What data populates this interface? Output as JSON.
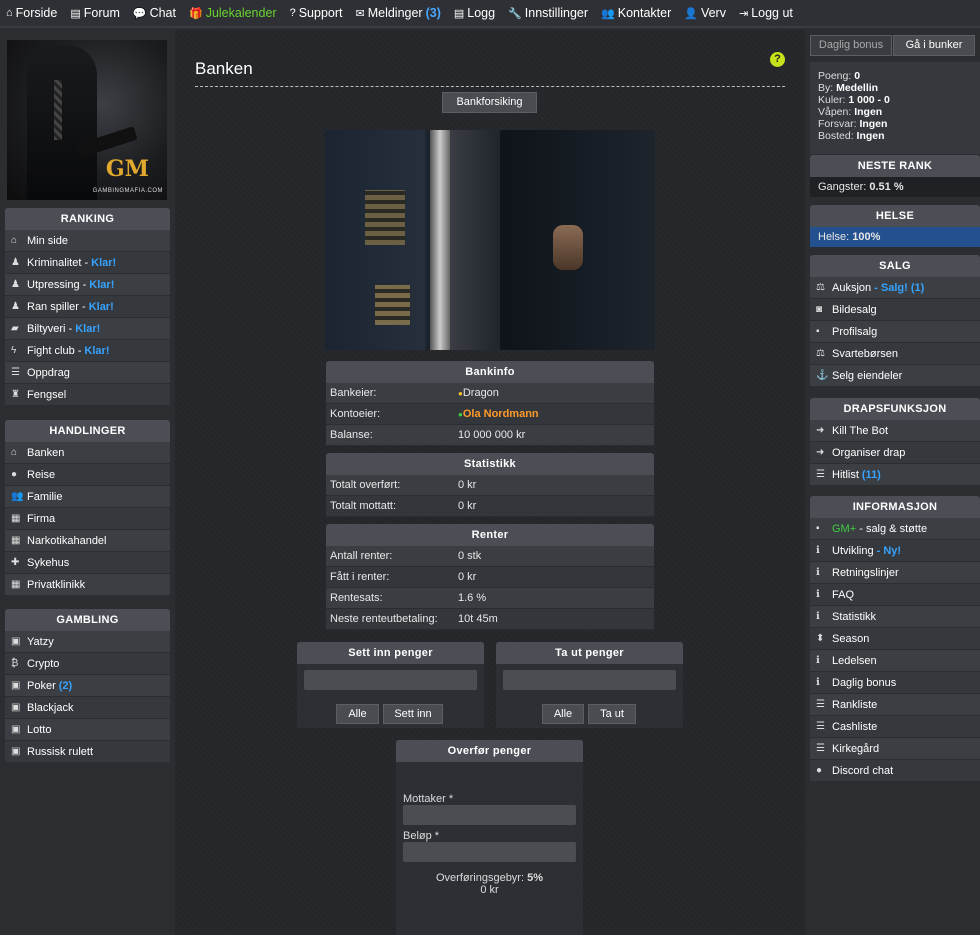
{
  "nav": [
    {
      "icon": "⌂",
      "label": "Forside",
      "icon_name": "home-icon"
    },
    {
      "icon": "▤",
      "label": "Forum",
      "icon_name": "forum-icon"
    },
    {
      "icon": "💬",
      "label": "Chat",
      "icon_name": "chat-icon"
    },
    {
      "icon": "🎁",
      "label": "Julekalender",
      "icon_name": "gift-icon"
    },
    {
      "icon": "?",
      "label": "Support",
      "icon_name": "question-icon"
    },
    {
      "icon": "✉",
      "label": "Meldinger",
      "count": "(3)",
      "icon_name": "envelope-icon"
    },
    {
      "icon": "▤",
      "label": "Logg",
      "icon_name": "list-icon"
    },
    {
      "icon": "🔧",
      "label": "Innstillinger",
      "icon_name": "wrench-icon"
    },
    {
      "icon": "👥",
      "label": "Kontakter",
      "icon_name": "users-icon"
    },
    {
      "icon": "👤",
      "label": "Verv",
      "icon_name": "user-plus-icon"
    },
    {
      "icon": "⇥",
      "label": "Logg ut",
      "icon_name": "logout-icon"
    }
  ],
  "logo": {
    "mark_g": "G",
    "mark_m": "M",
    "site": "GAMBINGMAFIA.COM"
  },
  "left": {
    "ranking": {
      "title": "RANKING",
      "items": [
        {
          "label": "Min side",
          "ready": ""
        },
        {
          "label": "Kriminalitet -",
          "ready": "Klar!"
        },
        {
          "label": "Utpressing -",
          "ready": "Klar!"
        },
        {
          "label": "Ran spiller -",
          "ready": "Klar!"
        },
        {
          "label": "Biltyveri -",
          "ready": "Klar!"
        },
        {
          "label": "Fight club -",
          "ready": "Klar!"
        },
        {
          "label": "Oppdrag",
          "ready": ""
        },
        {
          "label": "Fengsel",
          "ready": ""
        }
      ]
    },
    "handlinger": {
      "title": "HANDLINGER",
      "items": [
        "Banken",
        "Reise",
        "Familie",
        "Firma",
        "Narkotikahandel",
        "Sykehus",
        "Privatklinikk"
      ]
    },
    "gambling": {
      "title": "GAMBLING",
      "items": [
        {
          "label": "Yatzy",
          "count": ""
        },
        {
          "label": "Crypto",
          "count": ""
        },
        {
          "label": "Poker",
          "count": "(2)"
        },
        {
          "label": "Blackjack",
          "count": ""
        },
        {
          "label": "Lotto",
          "count": ""
        },
        {
          "label": "Russisk rulett",
          "count": ""
        }
      ]
    }
  },
  "main": {
    "title": "Banken",
    "help": "?",
    "bank_button": "Bankforsiking",
    "bankinfo": {
      "title": "Bankinfo",
      "rows": [
        {
          "k": "Bankeier:",
          "v": "Dragon"
        },
        {
          "k": "Kontoeier:",
          "v": "Ola Nordmann"
        },
        {
          "k": "Balanse:",
          "v": "10 000 000 kr"
        }
      ]
    },
    "statistikk": {
      "title": "Statistikk",
      "rows": [
        {
          "k": "Totalt overført:",
          "v": "0 kr"
        },
        {
          "k": "Totalt mottatt:",
          "v": "0 kr"
        }
      ]
    },
    "renter": {
      "title": "Renter",
      "rows": [
        {
          "k": "Antall renter:",
          "v": "0 stk"
        },
        {
          "k": "Fått i renter:",
          "v": "0 kr"
        },
        {
          "k": "Rentesats:",
          "v": "1.6 %"
        },
        {
          "k": "Neste renteutbetaling:",
          "v": "10t 45m"
        }
      ]
    },
    "deposit": {
      "title": "Sett inn penger",
      "all": "Alle",
      "submit": "Sett inn"
    },
    "withdraw": {
      "title": "Ta ut penger",
      "all": "Alle",
      "submit": "Ta ut"
    },
    "transfer": {
      "title": "Overfør penger",
      "recipient_label": "Mottaker *",
      "amount_label": "Beløp *",
      "fee_label": "Overføringsgebyr:",
      "fee_value": "5%",
      "fee_amount": "0 kr"
    }
  },
  "right": {
    "daily_bonus": "Daglig bonus",
    "bunker": "Gå i bunker",
    "stats": {
      "poeng_k": "Poeng:",
      "poeng_v": "0",
      "by_k": "By:",
      "by_v": "Medellin",
      "kuler_k": "Kuler:",
      "kuler_v": "1 000 - 0",
      "vapen_k": "Våpen:",
      "vapen_v": "Ingen",
      "forsvar_k": "Forsvar:",
      "forsvar_v": "Ingen",
      "bosted_k": "Bosted:",
      "bosted_v": "Ingen"
    },
    "neste_rank": {
      "title": "NESTE RANK",
      "label": "Gangster:",
      "value": "0.51 %"
    },
    "helse": {
      "title": "HELSE",
      "label": "Helse:",
      "value": "100%"
    },
    "salg": {
      "title": "SALG",
      "items": [
        {
          "label": "Auksjon",
          "extra": "- Salg! (1)"
        },
        {
          "label": "Bildesalg",
          "extra": ""
        },
        {
          "label": "Profilsalg",
          "extra": ""
        },
        {
          "label": "Svartebørsen",
          "extra": ""
        },
        {
          "label": "Selg eiendeler",
          "extra": ""
        }
      ]
    },
    "drap": {
      "title": "DRAPSFUNKSJON",
      "items": [
        {
          "label": "Kill The Bot",
          "extra": ""
        },
        {
          "label": "Organiser drap",
          "extra": ""
        },
        {
          "label": "Hitlist",
          "extra": "(11)"
        }
      ]
    },
    "info": {
      "title": "INFORMASJON",
      "items": [
        {
          "label": "GM+",
          "extra": "- salg & støtte"
        },
        {
          "label": "Utvikling",
          "extra": "- Ny!"
        },
        {
          "label": "Retningslinjer",
          "extra": ""
        },
        {
          "label": "FAQ",
          "extra": ""
        },
        {
          "label": "Statistikk",
          "extra": ""
        },
        {
          "label": "Season",
          "extra": ""
        },
        {
          "label": "Ledelsen",
          "extra": ""
        },
        {
          "label": "Daglig bonus",
          "extra": ""
        },
        {
          "label": "Rankliste",
          "extra": ""
        },
        {
          "label": "Cashliste",
          "extra": ""
        },
        {
          "label": "Kirkegård",
          "extra": ""
        },
        {
          "label": "Discord chat",
          "extra": ""
        }
      ]
    }
  }
}
